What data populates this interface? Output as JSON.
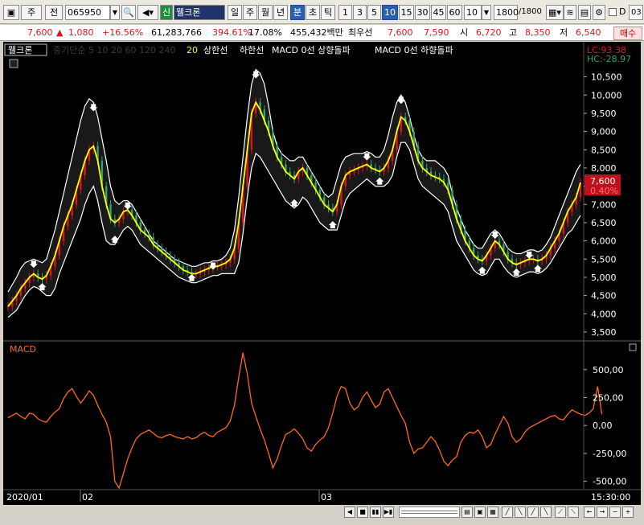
{
  "toolbar": {
    "mode1": "주",
    "mode2": "전",
    "code": "065950",
    "credit_tag": "신",
    "stock_name": "웰크론",
    "periods": [
      "일",
      "주",
      "월",
      "년",
      "분",
      "초",
      "틱"
    ],
    "minutes": [
      "1",
      "3",
      "5",
      "10",
      "15",
      "30",
      "45",
      "60"
    ],
    "count": "10",
    "range": "1800",
    "range_total": "/1800",
    "d_label": "D",
    "d_value": "03"
  },
  "quote": {
    "price": "7,600",
    "change": "1,080",
    "change_pct": "+16.56%",
    "volume": "61,283,766",
    "vol_ratio": "394.61%",
    "turnover": "17.08%",
    "amount": "455,432백만",
    "hoga_label": "최우선",
    "ask": "7,600",
    "bid": "7,590",
    "open_label": "시",
    "open": "6,720",
    "high_label": "고",
    "high": "8,350",
    "low_label": "저",
    "low": "6,540",
    "buy_label": "매수"
  },
  "legend": {
    "name": "웰크론",
    "faded": "중기단순 5 10 20 60 120 240",
    "twenty": "20",
    "items": [
      "상한선",
      "하한선",
      "MACD 0선 상향돌파",
      "MACD 0선 하향돌파"
    ]
  },
  "price_axis": {
    "ticks": [
      "10,500",
      "10,000",
      "9,500",
      "9,000",
      "8,500",
      "8,000",
      "7,500",
      "7,000",
      "6,500",
      "6,000",
      "5,500",
      "5,000",
      "4,500",
      "4,000",
      "3,500"
    ],
    "current_price": "7,600",
    "current_pct": "0.40%",
    "lc": "LC:93.38",
    "hc": "HC:-28.97"
  },
  "macd": {
    "label": "MACD",
    "ticks": [
      "500,00",
      "250,00",
      "0,00",
      "-250,00",
      "-500,00"
    ]
  },
  "time_axis": {
    "labels": [
      "2020/01",
      "02",
      "03"
    ],
    "last": "15:30:00"
  },
  "colors": {
    "bg": "#000000",
    "price_line": "#ffff00",
    "band": "#ffffff",
    "macd": "#ff6a1a",
    "up": "#e0141e",
    "down": "#2fa56b"
  },
  "chart_data": {
    "type": "line",
    "title": "",
    "ylim_price": [
      3300,
      10800
    ],
    "ylim_macd": [
      -560,
      700
    ],
    "price": [
      4200,
      4350,
      4500,
      4700,
      4850,
      5000,
      5100,
      5000,
      4950,
      5050,
      5300,
      5600,
      6000,
      6400,
      6700,
      7000,
      7400,
      7800,
      8200,
      8500,
      8600,
      8200,
      7500,
      7000,
      6600,
      6500,
      6600,
      6800,
      6850,
      6700,
      6500,
      6300,
      6200,
      6100,
      5900,
      5800,
      5700,
      5600,
      5500,
      5400,
      5300,
      5200,
      5150,
      5100,
      5100,
      5150,
      5200,
      5250,
      5300,
      5300,
      5350,
      5400,
      5500,
      5800,
      6500,
      7500,
      8500,
      9500,
      9800,
      9600,
      9300,
      9000,
      8600,
      8300,
      8100,
      7900,
      7800,
      7700,
      7900,
      8000,
      7800,
      7600,
      7400,
      7200,
      7000,
      6900,
      6800,
      7000,
      7500,
      7800,
      7900,
      7950,
      8000,
      8050,
      8100,
      8000,
      7950,
      7900,
      8000,
      8200,
      8500,
      9000,
      9400,
      9300,
      9000,
      8600,
      8200,
      8000,
      7900,
      7800,
      7750,
      7700,
      7600,
      7400,
      7000,
      6600,
      6300,
      6000,
      5800,
      5600,
      5500,
      5450,
      5600,
      5800,
      6000,
      5900,
      5700,
      5500,
      5400,
      5350,
      5400,
      5450,
      5500,
      5500,
      5450,
      5500,
      5600,
      5800,
      6000,
      6200,
      6500,
      6800,
      7000,
      7200,
      7600
    ],
    "upper": [
      4600,
      4800,
      5000,
      5250,
      5400,
      5450,
      5500,
      5450,
      5400,
      5500,
      5900,
      6300,
      6800,
      7300,
      7800,
      8300,
      8800,
      9300,
      9700,
      9900,
      9800,
      9400,
      8800,
      8200,
      7500,
      7100,
      7000,
      7100,
      7100,
      7000,
      6800,
      6600,
      6400,
      6200,
      6000,
      5900,
      5800,
      5700,
      5600,
      5500,
      5450,
      5400,
      5350,
      5300,
      5300,
      5350,
      5400,
      5400,
      5450,
      5450,
      5500,
      5600,
      5800,
      6300,
      7200,
      8300,
      9400,
      10300,
      10700,
      10600,
      10300,
      9700,
      9000,
      8600,
      8400,
      8300,
      8200,
      8200,
      8300,
      8300,
      8100,
      7900,
      7700,
      7500,
      7300,
      7200,
      7300,
      7700,
      8100,
      8300,
      8350,
      8400,
      8400,
      8400,
      8450,
      8400,
      8300,
      8300,
      8500,
      8900,
      9400,
      9800,
      10000,
      9800,
      9400,
      8900,
      8500,
      8300,
      8200,
      8200,
      8200,
      8100,
      8000,
      7800,
      7300,
      6900,
      6600,
      6300,
      6100,
      5900,
      5800,
      5800,
      6000,
      6200,
      6300,
      6200,
      6000,
      5800,
      5700,
      5650,
      5650,
      5700,
      5750,
      5750,
      5700,
      5750,
      5900,
      6100,
      6400,
      6700,
      7000,
      7300,
      7600,
      7900,
      8100
    ],
    "lower": [
      3900,
      4000,
      4100,
      4300,
      4500,
      4650,
      4750,
      4700,
      4600,
      4500,
      4500,
      4700,
      5100,
      5400,
      5700,
      6000,
      6300,
      6600,
      7000,
      7300,
      7500,
      7100,
      6500,
      6000,
      5900,
      5900,
      6100,
      6300,
      6400,
      6300,
      6100,
      5900,
      5800,
      5700,
      5600,
      5500,
      5400,
      5300,
      5200,
      5100,
      5000,
      4950,
      4900,
      4850,
      4850,
      4900,
      4950,
      5000,
      5050,
      5050,
      5100,
      5100,
      5100,
      5100,
      5400,
      6200,
      7200,
      8000,
      8400,
      8300,
      8100,
      7900,
      7700,
      7500,
      7300,
      7100,
      7000,
      6900,
      7000,
      7200,
      7100,
      6900,
      6700,
      6500,
      6400,
      6300,
      6300,
      6300,
      6700,
      7100,
      7300,
      7400,
      7500,
      7600,
      7700,
      7600,
      7500,
      7500,
      7500,
      7600,
      7800,
      8300,
      8700,
      8700,
      8500,
      8100,
      7700,
      7500,
      7400,
      7300,
      7200,
      7100,
      7000,
      6800,
      6400,
      6000,
      5800,
      5600,
      5400,
      5200,
      5100,
      5050,
      5100,
      5300,
      5500,
      5500,
      5300,
      5150,
      5050,
      5000,
      5050,
      5100,
      5150,
      5150,
      5100,
      5150,
      5250,
      5400,
      5600,
      5800,
      6000,
      6200,
      6300,
      6500,
      6700
    ],
    "macd": [
      70,
      90,
      110,
      80,
      60,
      110,
      100,
      60,
      40,
      30,
      80,
      120,
      150,
      240,
      300,
      330,
      260,
      200,
      250,
      310,
      270,
      180,
      100,
      30,
      -100,
      -500,
      -560,
      -430,
      -300,
      -200,
      -120,
      -80,
      -60,
      -40,
      -70,
      -100,
      -110,
      -90,
      -80,
      -100,
      -110,
      -120,
      -100,
      -120,
      -110,
      -80,
      -60,
      -90,
      -100,
      -60,
      -40,
      -20,
      40,
      180,
      430,
      650,
      460,
      200,
      80,
      -30,
      -130,
      -250,
      -380,
      -300,
      -180,
      -80,
      -60,
      -30,
      -70,
      -120,
      -200,
      -230,
      -170,
      -130,
      -100,
      -20,
      110,
      260,
      350,
      330,
      200,
      140,
      170,
      250,
      300,
      230,
      160,
      190,
      300,
      330,
      250,
      170,
      90,
      20,
      -150,
      -250,
      -210,
      -200,
      -150,
      -100,
      -140,
      -220,
      -320,
      -360,
      -310,
      -280,
      -150,
      -90,
      -60,
      -70,
      -40,
      -100,
      -200,
      -170,
      -80,
      0,
      80,
      20,
      -100,
      -150,
      -120,
      -60,
      -20,
      0,
      20,
      40,
      60,
      80,
      90,
      60,
      50,
      100,
      140,
      120,
      100,
      90,
      110,
      150,
      350,
      100
    ]
  }
}
